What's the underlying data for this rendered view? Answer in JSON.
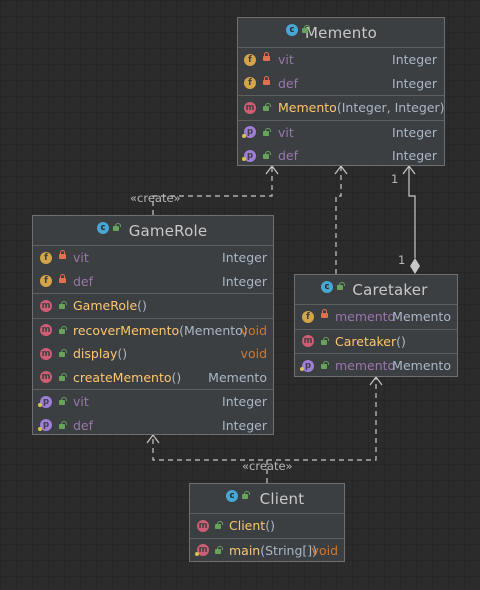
{
  "classes": {
    "memento": {
      "name": "Memento",
      "fields": [
        {
          "name": "vit",
          "type": "Integer"
        },
        {
          "name": "def",
          "type": "Integer"
        }
      ],
      "constructor": {
        "name": "Memento",
        "params": "(Integer, Integer)"
      },
      "properties": [
        {
          "name": "vit",
          "type": "Integer"
        },
        {
          "name": "def",
          "type": "Integer"
        }
      ]
    },
    "gamerole": {
      "name": "GameRole",
      "fields": [
        {
          "name": "vit",
          "type": "Integer"
        },
        {
          "name": "def",
          "type": "Integer"
        }
      ],
      "methods": [
        {
          "name": "GameRole",
          "params": "()",
          "type": ""
        },
        {
          "name": "recoverMemento",
          "params": "(Memento)",
          "type": "void"
        },
        {
          "name": "display",
          "params": "()",
          "type": "void"
        },
        {
          "name": "createMemento",
          "params": "()",
          "type": "Memento"
        }
      ],
      "properties": [
        {
          "name": "vit",
          "type": "Integer"
        },
        {
          "name": "def",
          "type": "Integer"
        }
      ]
    },
    "caretaker": {
      "name": "Caretaker",
      "fields": [
        {
          "name": "memento",
          "type": "Memento"
        }
      ],
      "constructor": {
        "name": "Caretaker",
        "params": "()"
      },
      "properties": [
        {
          "name": "memento",
          "type": "Memento"
        }
      ]
    },
    "client": {
      "name": "Client",
      "constructor": {
        "name": "Client",
        "params": "()"
      },
      "main": {
        "name": "main",
        "params": "(String[])",
        "type": "void"
      }
    }
  },
  "relations": {
    "gamerole_create_label": "«create»",
    "client_create_label": "«create»",
    "multiplicity_memento": "1",
    "multiplicity_caretaker": "1"
  },
  "badges": {
    "field": "f",
    "method": "m",
    "property": "p",
    "class": "c"
  },
  "colors": {
    "background": "#2b2b2b",
    "class_fill": "#3c3f41",
    "field_name": "#9876aa",
    "method_name": "#ffc66d",
    "void_type": "#cc7832"
  }
}
